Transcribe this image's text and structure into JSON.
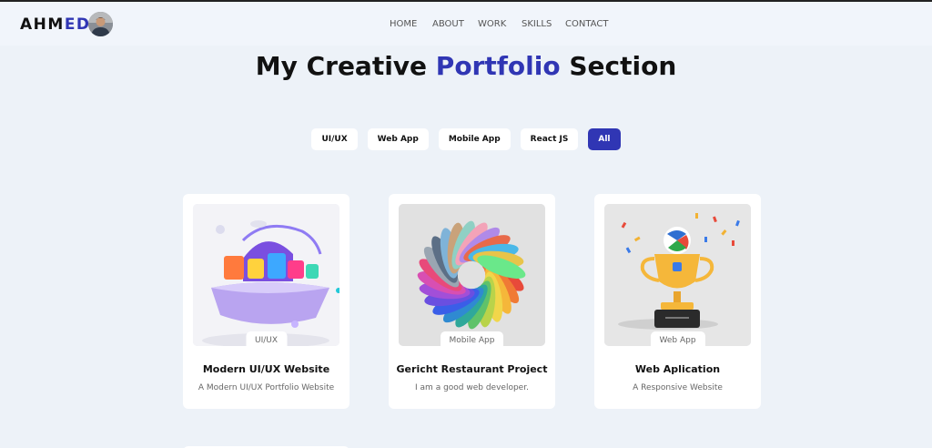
{
  "brand": {
    "name_part1": "AHM",
    "name_part2": "ED"
  },
  "nav": {
    "items": [
      "HOME",
      "ABOUT",
      "WORK",
      "SKILLS",
      "CONTACT"
    ]
  },
  "title": {
    "part1": "My Creative ",
    "accent": "Portfolio",
    "part2": " Section"
  },
  "filters": {
    "items": [
      "UI/UX",
      "Web App",
      "Mobile App",
      "React JS",
      "All"
    ],
    "active": "All"
  },
  "cards": [
    {
      "tag": "UI/UX",
      "title": "Modern UI/UX Website",
      "desc": "A Modern UI/UX Portfolio Website"
    },
    {
      "tag": "Mobile App",
      "title": "Gericht Restaurant Project",
      "desc": "I am a good web developer."
    },
    {
      "tag": "Web App",
      "title": "Web Aplication",
      "desc": "A Responsive Website"
    }
  ],
  "colors": {
    "accent": "#3036b4",
    "background": "#edf2f8"
  }
}
